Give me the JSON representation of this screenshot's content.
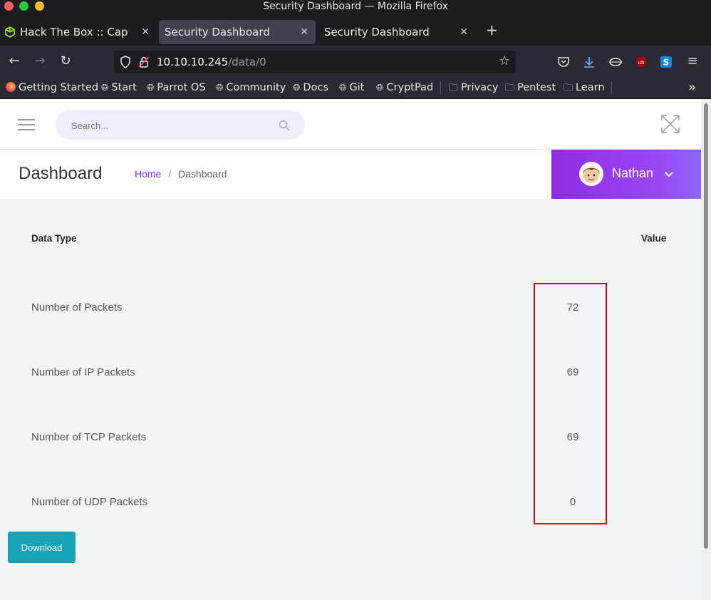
{
  "window": {
    "title": "Security Dashboard — Mozilla Firefox",
    "traffic_colors": [
      "#ff5f57",
      "#28c940",
      "#ffbd2e"
    ]
  },
  "tabs": [
    {
      "label": "Hack The Box :: Cap",
      "active": false,
      "icon": "cube-icon"
    },
    {
      "label": "Security Dashboard",
      "active": true
    },
    {
      "label": "Security Dashboard",
      "active": false
    }
  ],
  "nav": {
    "url_host": "10.10.10.245",
    "url_path": "/data/0"
  },
  "bookmarks": [
    {
      "label": "Getting Started",
      "icon": "firefox-icon"
    },
    {
      "label": "Start",
      "icon": "globe-icon"
    },
    {
      "label": "Parrot OS",
      "icon": "globe-icon"
    },
    {
      "label": "Community",
      "icon": "globe-icon"
    },
    {
      "label": "Docs",
      "icon": "globe-icon"
    },
    {
      "label": "Git",
      "icon": "globe-icon"
    },
    {
      "label": "CryptPad",
      "icon": "globe-icon"
    },
    {
      "label": "Privacy",
      "icon": "folder-icon"
    },
    {
      "label": "Pentest",
      "icon": "folder-icon"
    },
    {
      "label": "Learn",
      "icon": "folder-icon"
    }
  ],
  "app": {
    "search_placeholder": "Search...",
    "page_title": "Dashboard",
    "breadcrumb": {
      "home": "Home",
      "separator": "/",
      "current": "Dashboard"
    },
    "user_name": "Nathan",
    "accent_color": "#8e2de2",
    "link_color": "#7b2ff7"
  },
  "table": {
    "headers": {
      "type": "Data Type",
      "value": "Value"
    },
    "rows": [
      {
        "label": "Number of Packets",
        "value": "72"
      },
      {
        "label": "Number of IP Packets",
        "value": "69"
      },
      {
        "label": "Number of TCP Packets",
        "value": "69"
      },
      {
        "label": "Number of UDP Packets",
        "value": "0"
      }
    ]
  },
  "download_label": "Download"
}
